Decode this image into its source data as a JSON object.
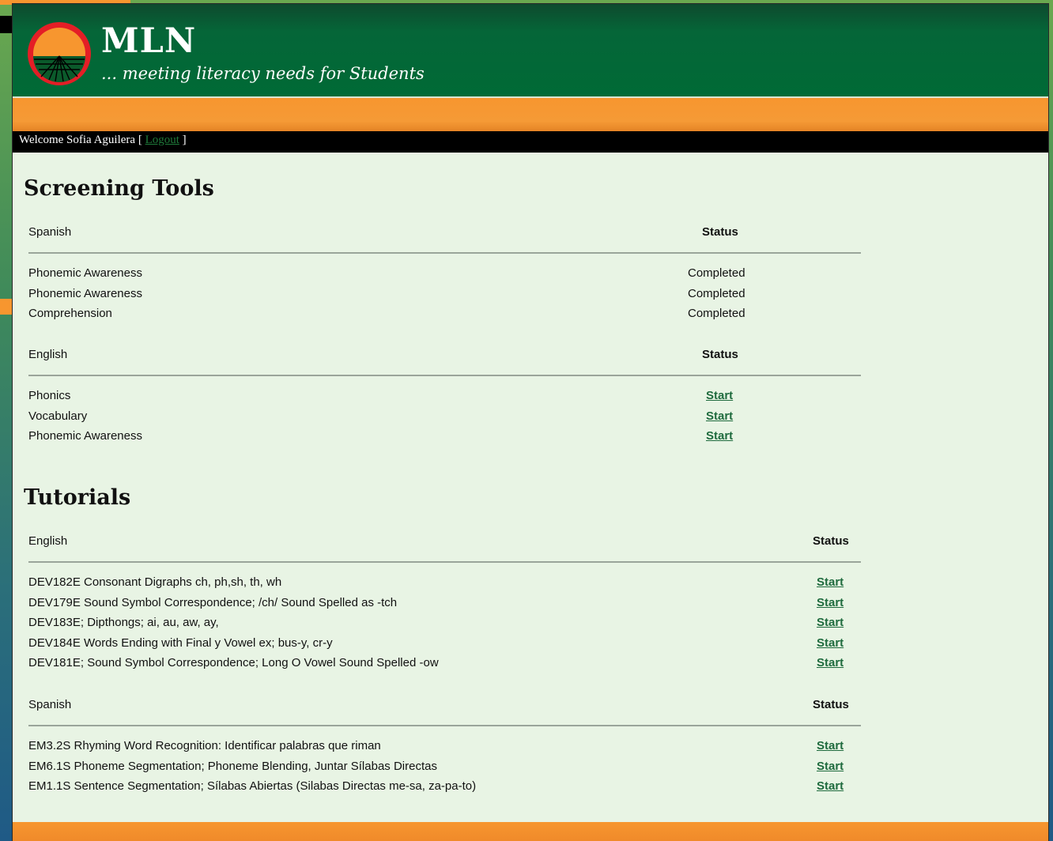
{
  "header": {
    "brand": "MLN",
    "tagline": "... meeting literacy needs for Students"
  },
  "welcome": {
    "prefix": "Welcome Sofia Aguilera [ ",
    "logout": "Logout",
    "suffix": " ]"
  },
  "screening": {
    "title": "Screening Tools",
    "groups": [
      {
        "heading": "Spanish",
        "status_heading": "Status",
        "items": [
          {
            "name": "Phonemic Awareness",
            "status": "Completed"
          },
          {
            "name": "Phonemic Awareness",
            "status": "Completed"
          },
          {
            "name": "Comprehension",
            "status": "Completed"
          }
        ]
      },
      {
        "heading": "English",
        "status_heading": "Status",
        "items": [
          {
            "name": "Phonics",
            "status": "Start"
          },
          {
            "name": "Vocabulary",
            "status": "Start"
          },
          {
            "name": "Phonemic Awareness",
            "status": "Start"
          }
        ]
      }
    ]
  },
  "tutorials": {
    "title": "Tutorials",
    "groups": [
      {
        "heading": "English",
        "status_heading": "Status",
        "items": [
          {
            "name": "DEV182E Consonant Digraphs ch, ph,sh, th, wh",
            "status": "Start"
          },
          {
            "name": "DEV179E Sound Symbol Correspondence; /ch/ Sound Spelled as -tch",
            "status": "Start"
          },
          {
            "name": "DEV183E; Dipthongs; ai, au, aw, ay,",
            "status": "Start"
          },
          {
            "name": "DEV184E Words Ending with Final y Vowel ex; bus-y, cr-y",
            "status": "Start"
          },
          {
            "name": "DEV181E; Sound Symbol Correspondence; Long O Vowel Sound Spelled -ow",
            "status": "Start"
          }
        ]
      },
      {
        "heading": "Spanish",
        "status_heading": "Status",
        "items": [
          {
            "name": "EM3.2S Rhyming Word Recognition: Identificar palabras que riman",
            "status": "Start"
          },
          {
            "name": "EM6.1S Phoneme Segmentation; Phoneme Blending, Juntar Sílabas Directas",
            "status": "Start"
          },
          {
            "name": "EM1.1S Sentence Segmentation; Sílabas Abiertas (Silabas Directas me-sa, za-pa-to)",
            "status": "Start"
          }
        ]
      }
    ]
  },
  "colors": {
    "header_green": "#006a36",
    "orange": "#f7962f",
    "content_bg": "#e8f4e4",
    "link_green": "#1f6b3e"
  }
}
